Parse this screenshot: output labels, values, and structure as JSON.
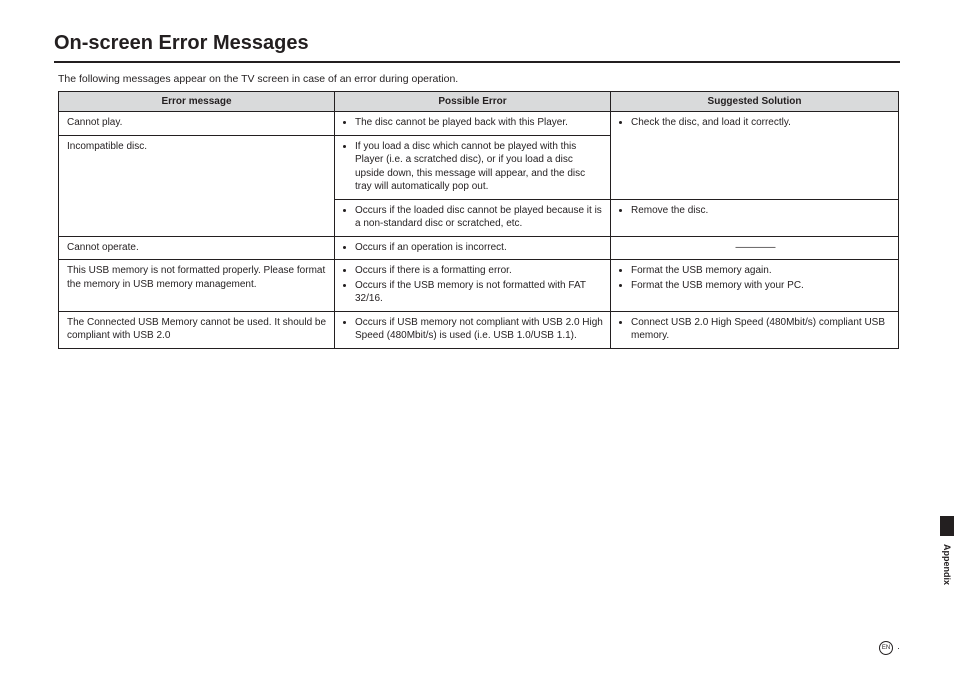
{
  "title": "On-screen Error Messages",
  "intro": "The following messages appear on the TV screen in case of an error during operation.",
  "columns": {
    "c0": "Error message",
    "c1": "Possible Error",
    "c2": "Suggested Solution"
  },
  "rows": {
    "r0": {
      "msg": "Cannot play.",
      "err0": "The disc cannot be played back with this Player.",
      "sol0": "Check the disc, and load it correctly."
    },
    "r1": {
      "msg": "Incompatible disc.",
      "err_a0": "If you load a disc which cannot be played with this Player (i.e. a scratched disc), or if you load a disc upside down, this message will appear, and the disc tray will automatically pop out.",
      "err_b0": "Occurs if the loaded disc cannot be played because it is a non-standard disc or scratched, etc.",
      "sol_b0": "Remove the disc."
    },
    "r2": {
      "msg": "Cannot operate.",
      "err0": "Occurs if an operation is incorrect.",
      "sol_dash": "————"
    },
    "r3": {
      "msg": "This USB memory is not formatted properly. Please format the memory in USB memory management.",
      "err0": "Occurs if there is a formatting error.",
      "err1": "Occurs if the USB memory is not formatted with FAT 32/16.",
      "sol0": "Format the USB memory again.",
      "sol1": "Format the USB memory with your PC."
    },
    "r4": {
      "msg": "The Connected USB Memory cannot be used. It should be compliant with USB 2.0",
      "err0": "Occurs if USB memory not compliant with USB 2.0 High Speed (480Mbit/s) is used (i.e. USB 1.0/USB 1.1).",
      "sol0": "Connect USB 2.0 High Speed (480Mbit/s) compliant USB memory."
    }
  },
  "side_label": "Appendix",
  "footer_lang": "EN"
}
